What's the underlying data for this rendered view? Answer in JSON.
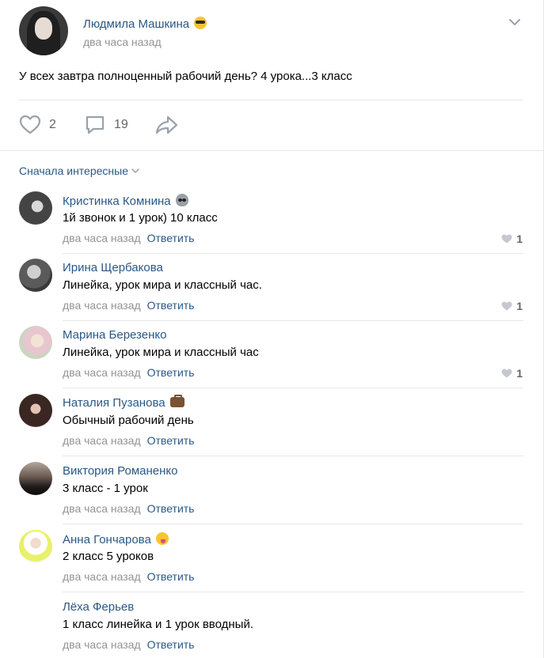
{
  "post": {
    "author": "Людмила Машкина",
    "author_emoji": "smiling-face-with-sunglasses-icon",
    "time": "два часа назад",
    "text": "У всех завтра полноценный рабочий день? 4 урока...3 класс",
    "likes": "2",
    "comments": "19"
  },
  "sort_label": "Сначала интересные",
  "comments": [
    {
      "author": "Кристинка Комнина",
      "emoji": "alien-icon",
      "text": "1й звонок и 1 урок) 10 класс",
      "time": "два часа назад",
      "reply": "Ответить",
      "likes": "1"
    },
    {
      "author": "Ирина Щербакова",
      "emoji": "",
      "text": "Линейка, урок мира и классный час.",
      "time": "два часа назад",
      "reply": "Ответить",
      "likes": "1"
    },
    {
      "author": "Марина Березенко",
      "emoji": "",
      "text": "Линейка, урок мира и классный час",
      "time": "два часа назад",
      "reply": "Ответить",
      "likes": "1"
    },
    {
      "author": "Наталия Пузанова",
      "emoji": "briefcase-icon",
      "text": "Обычный рабочий день",
      "time": "два часа назад",
      "reply": "Ответить",
      "likes": ""
    },
    {
      "author": "Виктория Романенко",
      "emoji": "",
      "text": "3 класс - 1 урок",
      "time": "два часа назад",
      "reply": "Ответить",
      "likes": ""
    },
    {
      "author": "Анна Гончарова",
      "emoji": "zany-face-icon",
      "text": "2 класс 5 уроков",
      "time": "два часа назад",
      "reply": "Ответить",
      "likes": ""
    },
    {
      "author": "Лёха Ферьев",
      "emoji": "",
      "text": "1 класс линейка и 1 урок вводный.",
      "time": "два часа назад",
      "reply": "Ответить",
      "likes": ""
    }
  ],
  "colors": {
    "link": "#2a5885",
    "muted": "#939393",
    "divider": "#e7e8ec",
    "icon": "#99a2ad"
  }
}
